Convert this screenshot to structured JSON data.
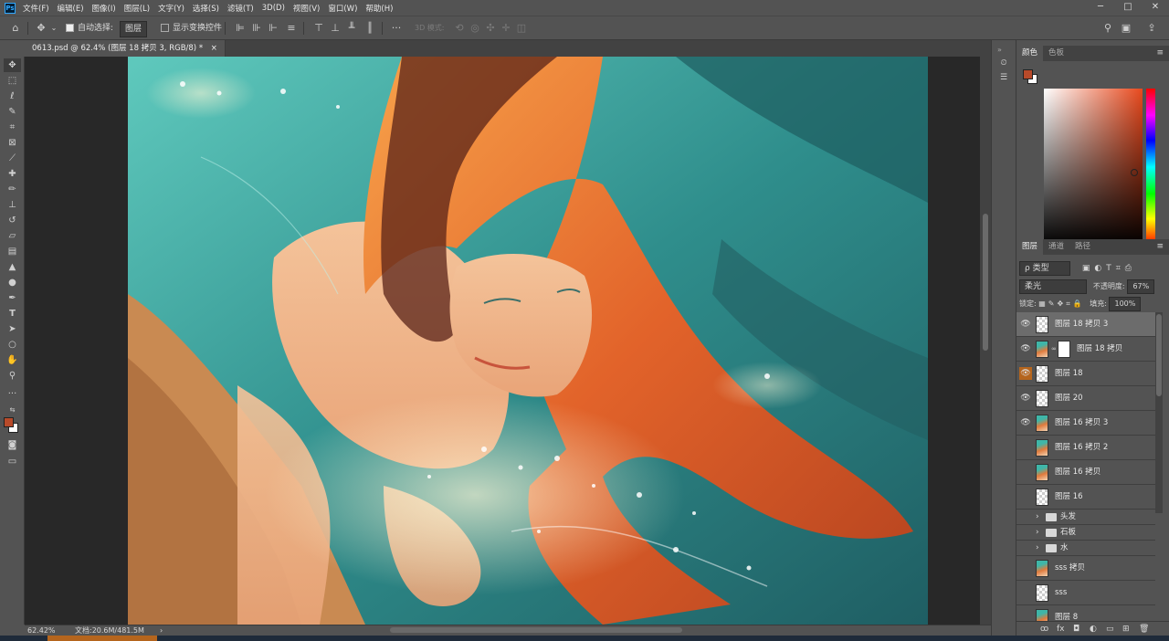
{
  "menubar": {
    "logo": "Ps",
    "items": [
      "文件(F)",
      "编辑(E)",
      "图像(I)",
      "图层(L)",
      "文字(Y)",
      "选择(S)",
      "滤镜(T)",
      "3D(D)",
      "视图(V)",
      "窗口(W)",
      "帮助(H)"
    ],
    "window_controls": [
      "─",
      "□",
      "✕"
    ]
  },
  "options_bar": {
    "auto_select_label": "自动选择:",
    "auto_select_value": "图层",
    "show_transform_label": "显示变换控件",
    "mode_3d_label": "3D 模式:",
    "more": "···"
  },
  "document_tab": {
    "title": "0613.psd @ 62.4% (图层 18 拷贝 3, RGB/8) *",
    "close": "×"
  },
  "status_bar": {
    "zoom": "62.42%",
    "doc_size": "文档:20.6M/481.5M",
    "arrow": "›"
  },
  "color_panel": {
    "tabs": [
      "颜色",
      "色板"
    ],
    "foreground_color": "#b84a2a",
    "background_color": "#ffffff"
  },
  "layers_panel": {
    "tabs": [
      "图层",
      "通道",
      "路径"
    ],
    "filter_label": "ρ 类型",
    "blend_mode": "柔光",
    "opacity_label": "不透明度:",
    "opacity_value": "67%",
    "lock_label": "锁定:",
    "fill_label": "填充:",
    "fill_value": "100%",
    "layers": [
      {
        "name": "图层 18 拷贝 3",
        "visible": true,
        "selected": true
      },
      {
        "name": "图层 18 拷贝",
        "visible": true,
        "selected": false
      },
      {
        "name": "图层 18",
        "visible": true,
        "selected": false
      },
      {
        "name": "图层 20",
        "visible": true,
        "selected": false
      },
      {
        "name": "图层 16 拷贝 3",
        "visible": true,
        "selected": false
      },
      {
        "name": "图层 16 拷贝 2",
        "visible": false,
        "selected": false
      },
      {
        "name": "图层 16 拷贝",
        "visible": false,
        "selected": false
      },
      {
        "name": "图层 16",
        "visible": false,
        "selected": false
      }
    ],
    "groups": [
      "头发",
      "石板",
      "水"
    ],
    "bottom_layers": [
      {
        "name": "sss 拷贝"
      },
      {
        "name": "sss"
      },
      {
        "name": "图层 8"
      }
    ],
    "footer_icons": [
      "link-icon",
      "fx-icon",
      "mask-icon",
      "adjustment-icon",
      "group-icon",
      "new-layer-icon",
      "trash-icon"
    ],
    "footer_glyphs": [
      "ꝏ",
      "fx",
      "◘",
      "◐",
      "▭",
      "⊞",
      "🗑"
    ]
  }
}
